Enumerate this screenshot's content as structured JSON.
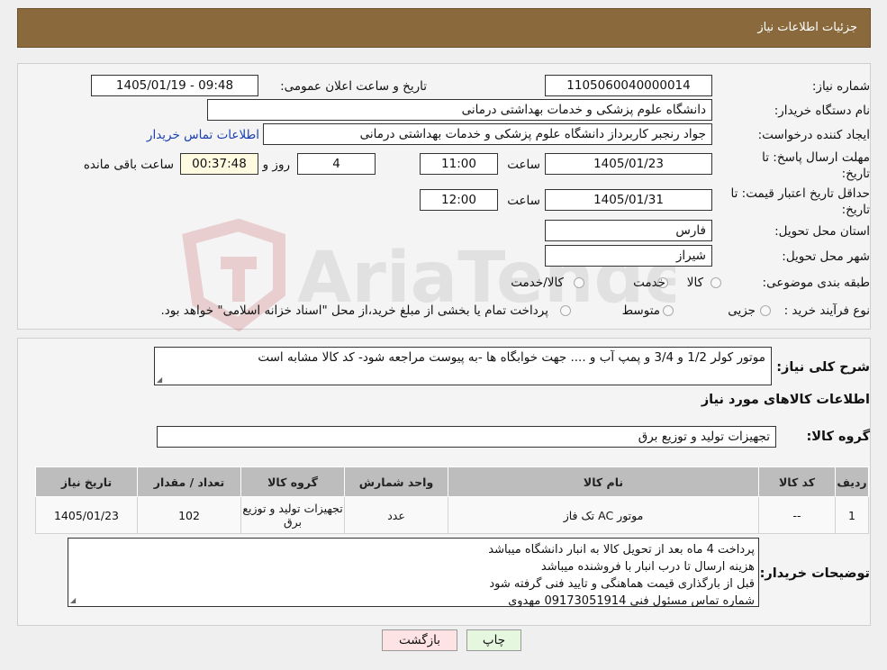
{
  "header": {
    "title": "جزئیات اطلاعات نیاز"
  },
  "watermark": {
    "text": "AriaTender.neT"
  },
  "form": {
    "need_number": {
      "label": "شماره نیاز:",
      "value": "1105060040000014"
    },
    "announce_datetime": {
      "label": "تاریخ و ساعت اعلان عمومی:",
      "value": "1405/01/19 - 09:48"
    },
    "buyer_org": {
      "label": "نام دستگاه خریدار:",
      "value": "دانشگاه علوم پزشکی و خدمات بهداشتی درمانی"
    },
    "requester": {
      "label": "ایجاد کننده درخواست:",
      "value": "جواد رنجبر کاربرداز دانشگاه علوم پزشکی و خدمات بهداشتی درمانی",
      "contact_link": "اطلاعات تماس خریدار"
    },
    "reply_deadline": {
      "label_line1": "مهلت ارسال پاسخ: تا",
      "label_line2": "تاریخ:",
      "date": "1405/01/23",
      "time_label": "ساعت",
      "time": "11:00",
      "days": "4",
      "days_label": "روز و",
      "remaining": "00:37:48",
      "remaining_label": "ساعت باقی مانده"
    },
    "price_validity": {
      "label_line1": "حداقل تاریخ اعتبار قیمت: تا",
      "label_line2": "تاریخ:",
      "date": "1405/01/31",
      "time_label": "ساعت",
      "time": "12:00"
    },
    "province": {
      "label": "استان محل تحویل:",
      "value": "فارس"
    },
    "city": {
      "label": "شهر محل تحویل:",
      "value": "شیراز"
    },
    "category": {
      "label": "طبقه بندی موضوعی:",
      "options": [
        "کالا",
        "خدمت",
        "کالا/خدمت"
      ]
    },
    "purchase_type": {
      "label": "نوع فرآیند خرید :",
      "options": [
        "جزیی",
        "متوسط"
      ],
      "note": "پرداخت تمام یا بخشی از مبلغ خرید،از محل \"اسناد خزانه اسلامی\" خواهد بود."
    }
  },
  "summary": {
    "label": "شرح کلی نیاز:",
    "value": "موتور کولر 1/2 و 3/4 و پمپ آب و .... جهت خوابگاه ها -به پیوست مراجعه شود- کد کالا مشابه است"
  },
  "goods_info_title": "اطلاعات کالاهای مورد نیاز",
  "goods_group": {
    "label": "گروه کالا:",
    "value": "تجهیزات تولید و توزیع برق"
  },
  "table": {
    "headers": [
      "ردیف",
      "کد کالا",
      "نام کالا",
      "واحد شمارش",
      "گروه کالا",
      "تعداد / مقدار",
      "تاریخ نیاز"
    ],
    "rows": [
      [
        "1",
        "--",
        "موتور AC تک فاز",
        "عدد",
        "تجهیزات تولید و توزیع برق",
        "102",
        "1405/01/23"
      ]
    ]
  },
  "buyer_notes": {
    "label": "توضیحات خریدار:",
    "lines": [
      "پرداخت 4 ماه بعد از تحویل کالا به انبار دانشگاه میباشد",
      "هزینه ارسال تا درب انبار با فروشنده میباشد",
      "قبل از بارگذاری قیمت هماهنگی و تایید فنی گرفته شود",
      "شماره تماس مسئول فنی 09173051914 مهدوی"
    ]
  },
  "buttons": {
    "print": "چاپ",
    "back": "بازگشت"
  },
  "colors": {
    "header_bg": "#8a6a3c",
    "print_btn_bg": "#e6f7e0",
    "back_btn_bg": "#fde3e3",
    "link": "#1a3fb0"
  }
}
